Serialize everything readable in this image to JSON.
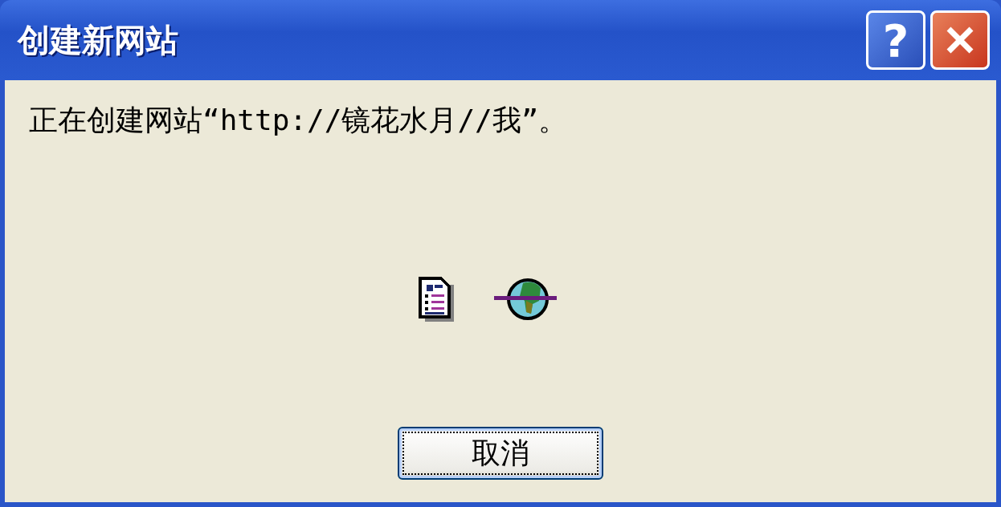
{
  "window": {
    "title": "创建新网站",
    "help_button": "?"
  },
  "message": "正在创建网站“http://镜花水月//我”。",
  "animation": {
    "kind": "file-transfer"
  },
  "buttons": [
    {
      "label": "取消",
      "focused": true
    }
  ]
}
